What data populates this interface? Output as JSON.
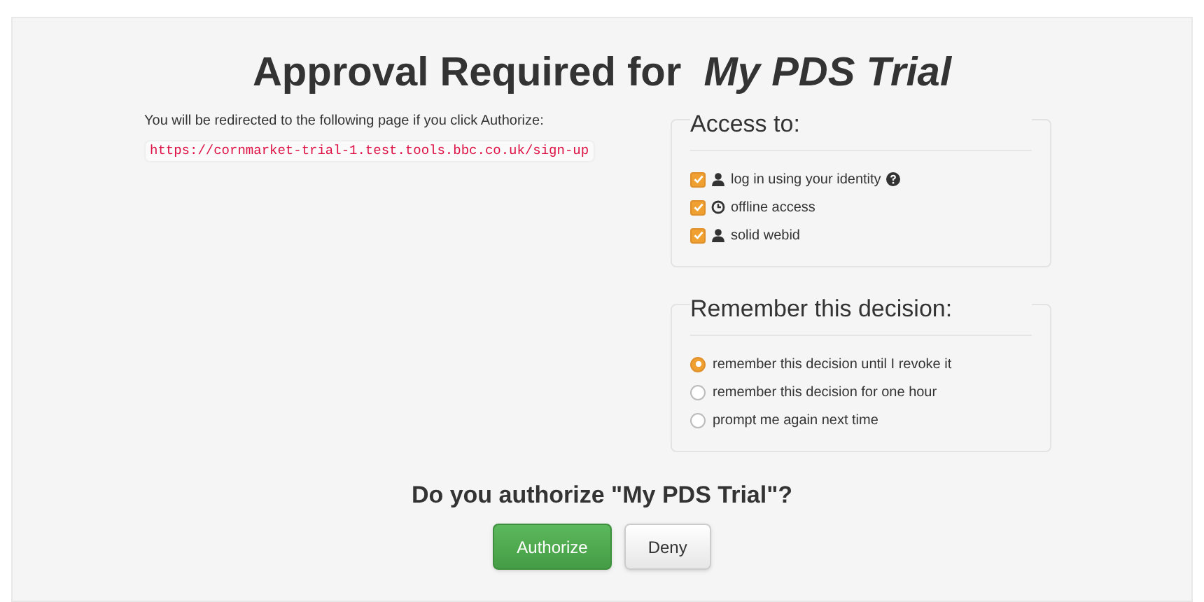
{
  "title": "Approval Required for  *My PDS Trial*",
  "redirect": {
    "text": "You will be redirected to the following page if you click Authorize:",
    "url": "https://cornmarket-trial-1.test.tools.bbc.co.uk/sign-up"
  },
  "access": {
    "legend": "Access to:",
    "scopes": [
      {
        "label": "log in using your identity",
        "kind": "profile",
        "checked": true,
        "help": true
      },
      {
        "label": "offline access",
        "kind": "offline",
        "checked": true,
        "help": false
      },
      {
        "label": "solid webid",
        "kind": "profile",
        "checked": true,
        "help": false
      }
    ]
  },
  "remember": {
    "legend": "Remember this decision:",
    "options": [
      {
        "label": "remember this decision until I revoke it",
        "selected": true
      },
      {
        "label": "remember this decision for one hour",
        "selected": false
      },
      {
        "label": "prompt me again next time",
        "selected": false
      }
    ]
  },
  "question": "Do you authorize \"My PDS Trial\"?",
  "buttons": [
    {
      "label": "Authorize",
      "kind": "primary"
    },
    {
      "label": "Deny",
      "kind": "default"
    }
  ]
}
